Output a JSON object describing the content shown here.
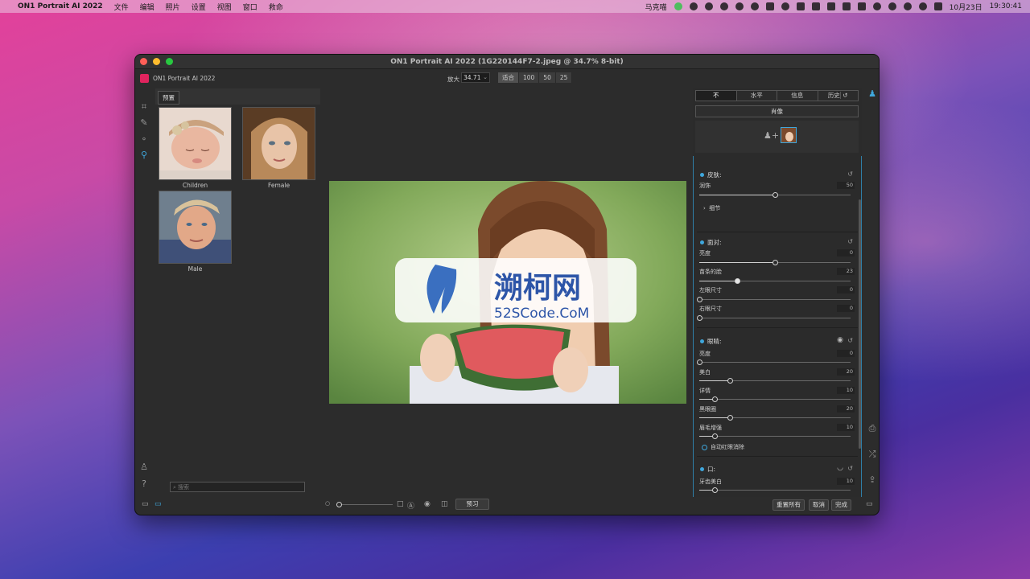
{
  "menubar": {
    "app_name": "ON1 Portrait AI 2022",
    "menus": [
      "文件",
      "编辑",
      "照片",
      "设置",
      "视图",
      "窗口",
      "救命"
    ],
    "user_name": "马克喵",
    "date": "10月23日",
    "time": "19:30:41"
  },
  "window": {
    "title": "ON1 Portrait AI 2022 (1G220144F7-2.jpeg @ 34.7% 8-bit)"
  },
  "toolbar": {
    "app_label": "ON1 Portrait AI 2022",
    "zoom_label": "放大",
    "zoom_value": "34.71",
    "zoom_buttons": [
      "适合",
      "100",
      "50",
      "25"
    ]
  },
  "presets": {
    "tab_label": "预置",
    "items": [
      {
        "caption": "Children"
      },
      {
        "caption": "Female"
      },
      {
        "caption": "Male"
      }
    ],
    "search_placeholder": "搜索"
  },
  "canvas": {
    "watermark_title": "溯柯网",
    "watermark_url": "52SCode.CoM"
  },
  "right_panel": {
    "tabs": [
      "不",
      "水平",
      "信息",
      "历史"
    ],
    "portrait_label": "肖像",
    "skin": {
      "title": "皮肤:",
      "sliders": [
        {
          "label": "润饰",
          "value": "50",
          "pct": 0.5
        }
      ],
      "detail_label": "细节"
    },
    "face": {
      "title": "面对:",
      "sliders": [
        {
          "label": "亮度",
          "value": "0",
          "pct": 0.5
        },
        {
          "label": "苗条的脸",
          "value": "23",
          "pct": 0.25
        },
        {
          "label": "左眼尺寸",
          "value": "0",
          "pct": 0.0
        },
        {
          "label": "右眼尺寸",
          "value": "0",
          "pct": 0.0
        }
      ]
    },
    "eyes": {
      "title": "眼睛:",
      "sliders": [
        {
          "label": "亮度",
          "value": "0",
          "pct": 0.0
        },
        {
          "label": "美白",
          "value": "20",
          "pct": 0.2
        },
        {
          "label": "详情",
          "value": "10",
          "pct": 0.1
        },
        {
          "label": "黑眼圈",
          "value": "20",
          "pct": 0.2
        },
        {
          "label": "眉毛增强",
          "value": "10",
          "pct": 0.1
        }
      ],
      "auto_redeye_label": "自动红眼消除"
    },
    "mouth": {
      "title": "口:",
      "sliders": [
        {
          "label": "牙齿美白",
          "value": "10",
          "pct": 0.1
        }
      ]
    }
  },
  "bottom": {
    "preview_label": "预习",
    "reset_all_label": "重置所有",
    "cancel_label": "取消",
    "done_label": "完成"
  }
}
